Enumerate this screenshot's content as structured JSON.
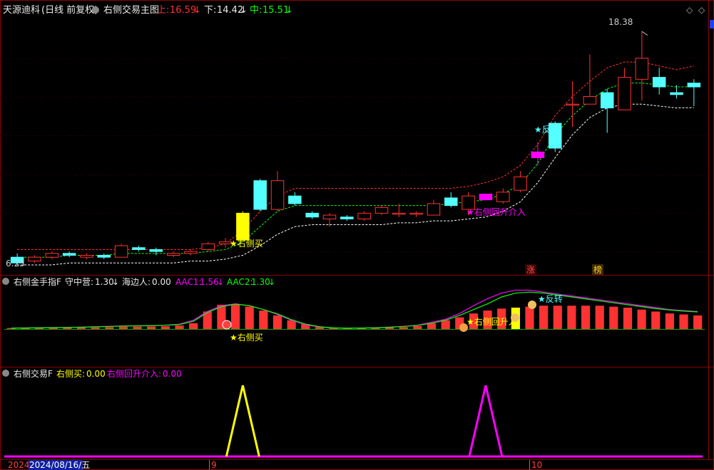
{
  "header": {
    "stock_name": "天源迪科",
    "period": "(日线 前复权)",
    "indicator_name": "右侧交易主图",
    "upper_label": "上:",
    "upper_value": "16.59",
    "lower_label": "下:",
    "lower_value": "14.42",
    "mid_label": "中:",
    "mid_value": "15.51"
  },
  "panel2_header": {
    "name": "右侧金手指F",
    "shouzhong_label": "守中营:",
    "shouzhong_value": "1.30",
    "haibian_label": "海边人:",
    "haibian_value": "0.00",
    "aac1_label": "AAC1:",
    "aac1_value": "1.56",
    "aac2_label": "AAC2:",
    "aac2_value": "1.30"
  },
  "panel3_header": {
    "name": "右侧交易F",
    "buy_label": "右侧买:",
    "buy_value": "0.00",
    "pullback_label": "右侧回升介入:",
    "pullback_value": "0.00"
  },
  "annotations": {
    "price_high": "18.38",
    "price_low": "6.23",
    "signal_buy": "★右侧买",
    "signal_pullback": "★右侧回升介入",
    "signal_reversal": "★反转",
    "marker_zhang": "涨",
    "marker_bang": "榜",
    "panel2_buy": "★右侧买",
    "panel2_pullback": "★右侧回升入",
    "panel2_reversal": "★反转"
  },
  "xaxis": {
    "year": "2024",
    "cursor_date": "2024/08/16/五",
    "month_labels": [
      "9",
      "10"
    ]
  },
  "colors": {
    "up": "#ff3232",
    "down": "#54ffff",
    "signal_yellow": "#ffff00",
    "magenta": "#ff00ff",
    "green_line": "#00ff00",
    "grid": "#8b0000",
    "upper_band": "#ff3232",
    "lower_band": "#ffffff"
  },
  "chart_data": [
    {
      "type": "candlestick",
      "title": "右侧交易主图",
      "x": [
        "d1",
        "d2",
        "d3",
        "d4",
        "d5",
        "d6",
        "d7",
        "d8",
        "d9",
        "d10",
        "d11",
        "d12",
        "d13",
        "d14",
        "d15",
        "d16",
        "d17",
        "d18",
        "d19",
        "d20",
        "d21",
        "d22",
        "d23",
        "d24",
        "d25",
        "d26",
        "d27",
        "d28",
        "d29",
        "d30",
        "d31",
        "d32",
        "d33",
        "d34",
        "d35",
        "d36",
        "d37",
        "d38",
        "d39",
        "d40"
      ],
      "ohlc": [
        [
          6.6,
          6.8,
          6.2,
          6.3
        ],
        [
          6.4,
          6.7,
          6.3,
          6.6
        ],
        [
          6.6,
          6.9,
          6.5,
          6.8
        ],
        [
          6.8,
          6.9,
          6.6,
          6.7
        ],
        [
          6.6,
          6.8,
          6.5,
          6.7
        ],
        [
          6.7,
          6.8,
          6.5,
          6.6
        ],
        [
          6.6,
          7.3,
          6.6,
          7.2
        ],
        [
          7.1,
          7.2,
          6.9,
          7.0
        ],
        [
          7.0,
          7.1,
          6.7,
          6.9
        ],
        [
          6.7,
          6.9,
          6.6,
          6.8
        ],
        [
          6.8,
          7.0,
          6.7,
          6.9
        ],
        [
          7.0,
          7.4,
          6.9,
          7.3
        ],
        [
          7.3,
          7.6,
          7.1,
          7.4
        ],
        [
          7.5,
          9.0,
          7.5,
          8.9
        ],
        [
          10.6,
          10.7,
          9.0,
          9.1
        ],
        [
          9.1,
          11.1,
          9.0,
          10.6
        ],
        [
          9.8,
          10.0,
          9.3,
          9.4
        ],
        [
          8.9,
          9.0,
          8.6,
          8.7
        ],
        [
          8.6,
          8.9,
          8.2,
          8.8
        ],
        [
          8.7,
          8.8,
          8.5,
          8.6
        ],
        [
          8.6,
          9.0,
          8.5,
          8.9
        ],
        [
          8.9,
          9.3,
          8.8,
          9.2
        ],
        [
          8.9,
          9.4,
          8.7,
          8.9
        ],
        [
          8.9,
          9.0,
          8.7,
          8.9
        ],
        [
          8.8,
          9.6,
          8.8,
          9.4
        ],
        [
          9.7,
          10.0,
          9.2,
          9.3
        ],
        [
          9.1,
          10.0,
          8.8,
          9.8
        ],
        [
          9.9,
          9.6,
          9.6,
          9.6
        ],
        [
          9.5,
          10.2,
          9.4,
          10.0
        ],
        [
          10.1,
          11.1,
          10.0,
          10.8
        ],
        [
          11.8,
          12.6,
          11.4,
          12.1
        ],
        [
          13.6,
          13.7,
          12.1,
          12.3
        ],
        [
          14.6,
          15.8,
          13.4,
          14.6
        ],
        [
          14.6,
          17.2,
          14.6,
          15.0
        ],
        [
          15.2,
          15.4,
          13.1,
          14.4
        ],
        [
          14.3,
          16.5,
          14.3,
          16.0
        ],
        [
          15.9,
          18.4,
          14.8,
          17.0
        ],
        [
          16.0,
          16.5,
          15.1,
          15.5
        ],
        [
          15.2,
          15.6,
          14.9,
          15.1
        ],
        [
          15.7,
          15.9,
          14.5,
          15.5
        ]
      ],
      "upper_band": [
        7.0,
        7.0,
        7.0,
        7.0,
        7.0,
        7.0,
        7.0,
        7.0,
        7.0,
        7.0,
        7.0,
        7.1,
        7.3,
        8.0,
        9.0,
        9.8,
        10.2,
        10.2,
        10.2,
        10.2,
        10.2,
        10.2,
        10.2,
        10.2,
        10.2,
        10.2,
        10.3,
        10.5,
        10.8,
        11.4,
        12.5,
        14.0,
        15.0,
        15.8,
        16.5,
        16.8,
        16.8,
        16.6,
        16.4,
        16.59
      ],
      "middle_line": [
        6.6,
        6.6,
        6.6,
        6.7,
        6.7,
        6.7,
        6.8,
        6.8,
        6.8,
        6.8,
        6.8,
        6.9,
        7.0,
        7.4,
        8.2,
        9.0,
        9.3,
        9.3,
        9.3,
        9.3,
        9.3,
        9.3,
        9.3,
        9.3,
        9.3,
        9.4,
        9.5,
        9.6,
        9.9,
        10.4,
        11.5,
        13.0,
        14.0,
        14.8,
        15.4,
        15.7,
        15.7,
        15.6,
        15.5,
        15.51
      ],
      "lower_band": [
        6.2,
        6.2,
        6.2,
        6.3,
        6.3,
        6.3,
        6.3,
        6.3,
        6.3,
        6.3,
        6.4,
        6.4,
        6.5,
        6.7,
        7.2,
        7.8,
        8.2,
        8.3,
        8.3,
        8.3,
        8.3,
        8.3,
        8.4,
        8.4,
        8.5,
        8.5,
        8.6,
        8.7,
        9.0,
        9.5,
        10.5,
        11.8,
        13.0,
        13.9,
        14.4,
        14.6,
        14.6,
        14.5,
        14.4,
        14.42
      ],
      "ylim": [
        5.9,
        19.0
      ]
    },
    {
      "type": "bar",
      "title": "右侧金手指F",
      "values": [
        0.05,
        0.05,
        0.06,
        0.06,
        0.07,
        0.07,
        0.08,
        0.1,
        0.12,
        0.12,
        0.13,
        0.14,
        0.18,
        0.3,
        0.9,
        1.25,
        1.28,
        1.15,
        0.95,
        0.7,
        0.45,
        0.25,
        0.1,
        0.05,
        0.03,
        0.04,
        0.05,
        0.08,
        0.1,
        0.15,
        0.3,
        0.45,
        0.6,
        0.8,
        0.95,
        1.05,
        1.1,
        1.15,
        1.2,
        1.2,
        1.2,
        1.2,
        1.2,
        1.15,
        1.1,
        1.0,
        0.9,
        0.8,
        0.75,
        0.7
      ],
      "aac1": [
        0.05,
        0.06,
        0.07,
        0.08,
        0.09,
        0.1,
        0.12,
        0.14,
        0.16,
        0.17,
        0.18,
        0.2,
        0.25,
        0.45,
        0.9,
        1.2,
        1.3,
        1.2,
        1.0,
        0.75,
        0.45,
        0.22,
        0.1,
        0.05,
        0.04,
        0.05,
        0.07,
        0.1,
        0.14,
        0.2,
        0.35,
        0.5,
        0.8,
        1.2,
        1.56,
        1.85,
        2.0,
        2.0,
        1.9,
        1.8,
        1.7,
        1.6,
        1.5,
        1.4,
        1.3,
        1.2,
        1.1,
        1.0,
        0.95,
        0.9
      ],
      "aac2": [
        0.04,
        0.05,
        0.06,
        0.07,
        0.08,
        0.09,
        0.11,
        0.13,
        0.15,
        0.16,
        0.17,
        0.19,
        0.23,
        0.4,
        0.85,
        1.15,
        1.28,
        1.2,
        1.0,
        0.78,
        0.48,
        0.25,
        0.12,
        0.06,
        0.04,
        0.05,
        0.06,
        0.09,
        0.13,
        0.18,
        0.3,
        0.45,
        0.7,
        1.0,
        1.3,
        1.65,
        1.85,
        1.9,
        1.85,
        1.75,
        1.65,
        1.55,
        1.45,
        1.35,
        1.25,
        1.15,
        1.05,
        0.98,
        0.92,
        0.88
      ],
      "ylim": [
        -0.1,
        2.2
      ]
    },
    {
      "type": "line",
      "title": "右侧交易F",
      "series": [
        {
          "name": "右侧买",
          "spike_at": 13,
          "value": 1
        },
        {
          "name": "右侧回升介入",
          "spike_at": 27,
          "value": 1
        }
      ],
      "ylim": [
        0,
        1.2
      ]
    }
  ]
}
